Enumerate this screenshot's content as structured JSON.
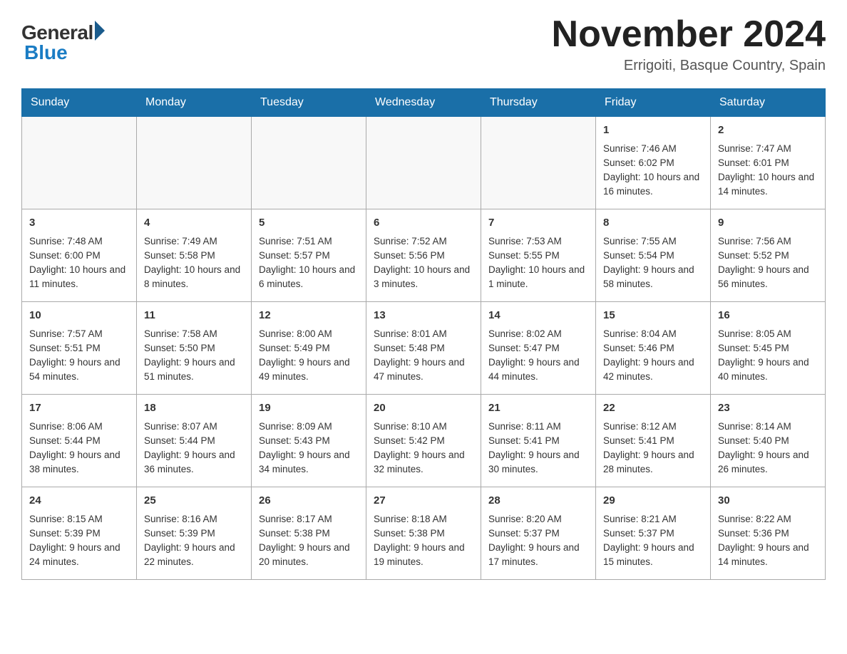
{
  "header": {
    "logo_general": "General",
    "logo_blue": "Blue",
    "month_year": "November 2024",
    "location": "Errigoiti, Basque Country, Spain"
  },
  "days_of_week": [
    "Sunday",
    "Monday",
    "Tuesday",
    "Wednesday",
    "Thursday",
    "Friday",
    "Saturday"
  ],
  "weeks": [
    [
      {
        "day": "",
        "info": ""
      },
      {
        "day": "",
        "info": ""
      },
      {
        "day": "",
        "info": ""
      },
      {
        "day": "",
        "info": ""
      },
      {
        "day": "",
        "info": ""
      },
      {
        "day": "1",
        "info": "Sunrise: 7:46 AM\nSunset: 6:02 PM\nDaylight: 10 hours and 16 minutes."
      },
      {
        "day": "2",
        "info": "Sunrise: 7:47 AM\nSunset: 6:01 PM\nDaylight: 10 hours and 14 minutes."
      }
    ],
    [
      {
        "day": "3",
        "info": "Sunrise: 7:48 AM\nSunset: 6:00 PM\nDaylight: 10 hours and 11 minutes."
      },
      {
        "day": "4",
        "info": "Sunrise: 7:49 AM\nSunset: 5:58 PM\nDaylight: 10 hours and 8 minutes."
      },
      {
        "day": "5",
        "info": "Sunrise: 7:51 AM\nSunset: 5:57 PM\nDaylight: 10 hours and 6 minutes."
      },
      {
        "day": "6",
        "info": "Sunrise: 7:52 AM\nSunset: 5:56 PM\nDaylight: 10 hours and 3 minutes."
      },
      {
        "day": "7",
        "info": "Sunrise: 7:53 AM\nSunset: 5:55 PM\nDaylight: 10 hours and 1 minute."
      },
      {
        "day": "8",
        "info": "Sunrise: 7:55 AM\nSunset: 5:54 PM\nDaylight: 9 hours and 58 minutes."
      },
      {
        "day": "9",
        "info": "Sunrise: 7:56 AM\nSunset: 5:52 PM\nDaylight: 9 hours and 56 minutes."
      }
    ],
    [
      {
        "day": "10",
        "info": "Sunrise: 7:57 AM\nSunset: 5:51 PM\nDaylight: 9 hours and 54 minutes."
      },
      {
        "day": "11",
        "info": "Sunrise: 7:58 AM\nSunset: 5:50 PM\nDaylight: 9 hours and 51 minutes."
      },
      {
        "day": "12",
        "info": "Sunrise: 8:00 AM\nSunset: 5:49 PM\nDaylight: 9 hours and 49 minutes."
      },
      {
        "day": "13",
        "info": "Sunrise: 8:01 AM\nSunset: 5:48 PM\nDaylight: 9 hours and 47 minutes."
      },
      {
        "day": "14",
        "info": "Sunrise: 8:02 AM\nSunset: 5:47 PM\nDaylight: 9 hours and 44 minutes."
      },
      {
        "day": "15",
        "info": "Sunrise: 8:04 AM\nSunset: 5:46 PM\nDaylight: 9 hours and 42 minutes."
      },
      {
        "day": "16",
        "info": "Sunrise: 8:05 AM\nSunset: 5:45 PM\nDaylight: 9 hours and 40 minutes."
      }
    ],
    [
      {
        "day": "17",
        "info": "Sunrise: 8:06 AM\nSunset: 5:44 PM\nDaylight: 9 hours and 38 minutes."
      },
      {
        "day": "18",
        "info": "Sunrise: 8:07 AM\nSunset: 5:44 PM\nDaylight: 9 hours and 36 minutes."
      },
      {
        "day": "19",
        "info": "Sunrise: 8:09 AM\nSunset: 5:43 PM\nDaylight: 9 hours and 34 minutes."
      },
      {
        "day": "20",
        "info": "Sunrise: 8:10 AM\nSunset: 5:42 PM\nDaylight: 9 hours and 32 minutes."
      },
      {
        "day": "21",
        "info": "Sunrise: 8:11 AM\nSunset: 5:41 PM\nDaylight: 9 hours and 30 minutes."
      },
      {
        "day": "22",
        "info": "Sunrise: 8:12 AM\nSunset: 5:41 PM\nDaylight: 9 hours and 28 minutes."
      },
      {
        "day": "23",
        "info": "Sunrise: 8:14 AM\nSunset: 5:40 PM\nDaylight: 9 hours and 26 minutes."
      }
    ],
    [
      {
        "day": "24",
        "info": "Sunrise: 8:15 AM\nSunset: 5:39 PM\nDaylight: 9 hours and 24 minutes."
      },
      {
        "day": "25",
        "info": "Sunrise: 8:16 AM\nSunset: 5:39 PM\nDaylight: 9 hours and 22 minutes."
      },
      {
        "day": "26",
        "info": "Sunrise: 8:17 AM\nSunset: 5:38 PM\nDaylight: 9 hours and 20 minutes."
      },
      {
        "day": "27",
        "info": "Sunrise: 8:18 AM\nSunset: 5:38 PM\nDaylight: 9 hours and 19 minutes."
      },
      {
        "day": "28",
        "info": "Sunrise: 8:20 AM\nSunset: 5:37 PM\nDaylight: 9 hours and 17 minutes."
      },
      {
        "day": "29",
        "info": "Sunrise: 8:21 AM\nSunset: 5:37 PM\nDaylight: 9 hours and 15 minutes."
      },
      {
        "day": "30",
        "info": "Sunrise: 8:22 AM\nSunset: 5:36 PM\nDaylight: 9 hours and 14 minutes."
      }
    ]
  ]
}
